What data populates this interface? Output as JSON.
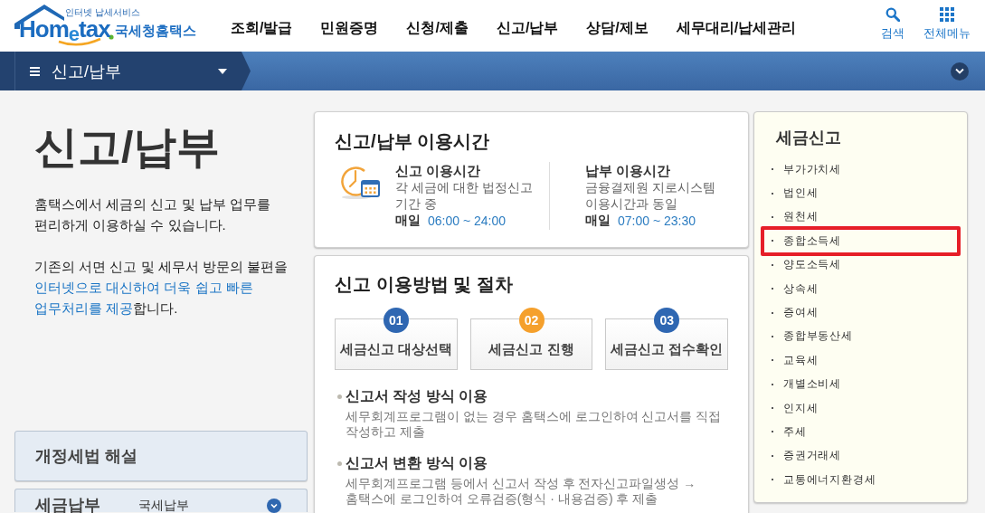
{
  "header": {
    "logo": {
      "tagline": "인터넷 납세서비스",
      "wordmark": "Hom$_{e}$tax",
      "site_name": "국세청홈택스"
    },
    "nav": [
      {
        "label": "조회/발급"
      },
      {
        "label": "민원증명"
      },
      {
        "label": "신청/제출"
      },
      {
        "label": "신고/납부"
      },
      {
        "label": "상담/제보"
      },
      {
        "label": "세무대리/납세관리"
      }
    ],
    "utilities": [
      {
        "kind": "search",
        "label": "검색"
      },
      {
        "kind": "all_menu",
        "label": "전체메뉴"
      }
    ]
  },
  "section_bar": {
    "current": "신고/납부"
  },
  "intro": {
    "title": "신고/납부",
    "paragraphs": [
      [
        {
          "kind": "plain",
          "text": "홈택스에서 세금의 신고 및 납부 업무를\n편리하게 이용하실 수 있습니다."
        }
      ],
      [
        {
          "kind": "plain",
          "text": "기존의 서면 신고 및 세무서 방문의 불편을\n"
        },
        {
          "kind": "emphasis",
          "text": "인터넷으로 대신하여 더욱 쉽고 빠른\n업무처리를 제공"
        },
        {
          "kind": "plain",
          "text": "합니다."
        }
      ]
    ]
  },
  "side_links": [
    {
      "label": "개정세법 해설"
    },
    {
      "label": "세금납부",
      "sublabel": "국세납부"
    }
  ],
  "hours": {
    "title": "신고/납부 이용시간",
    "columns": [
      {
        "heading": "신고 이용시간",
        "description": "각 세금에 대한 법정신고\n기간 중",
        "day_label": "매일",
        "time": "06:00 ~ 24:00"
      },
      {
        "heading": "납부 이용시간",
        "description": "금융결제원 지로시스템\n이용시간과 동일",
        "day_label": "매일",
        "time": "07:00 ~ 23:30"
      }
    ]
  },
  "procedure": {
    "title": "신고 이용방법 및 절차",
    "steps": [
      {
        "number": "01",
        "label": "세금신고 대상선택",
        "color": "#2f67b2"
      },
      {
        "number": "02",
        "label": "세금신고 진행",
        "color": "#f5a02c"
      },
      {
        "number": "03",
        "label": "세금신고 접수확인",
        "color": "#2f67b2"
      }
    ],
    "methods": [
      {
        "heading": "신고서 작성 방식 이용",
        "description": "세무회계프로그램이 없는 경우 홈택스에 로그인하여 신고서를 직접\n작성하고 제출"
      },
      {
        "heading": "신고서 변환 방식 이용",
        "description": "세무회계프로그램 등에서 신고서 작성 후 전자신고파일생성 →\n홈택스에 로그인하여 오류검증(형식 · 내용검증) 후 제출"
      }
    ]
  },
  "tax_filing": {
    "title": "세금신고",
    "items": [
      {
        "label": "부가가치세",
        "highlighted": false
      },
      {
        "label": "법인세",
        "highlighted": false
      },
      {
        "label": "원천세",
        "highlighted": false
      },
      {
        "label": "종합소득세",
        "highlighted": true
      },
      {
        "label": "양도소득세",
        "highlighted": false
      },
      {
        "label": "상속세",
        "highlighted": false
      },
      {
        "label": "증여세",
        "highlighted": false
      },
      {
        "label": "종합부동산세",
        "highlighted": false
      },
      {
        "label": "교육세",
        "highlighted": false
      },
      {
        "label": "개별소비세",
        "highlighted": false
      },
      {
        "label": "인지세",
        "highlighted": false
      },
      {
        "label": "주세",
        "highlighted": false
      },
      {
        "label": "증권거래세",
        "highlighted": false
      },
      {
        "label": "교통에너지환경세",
        "highlighted": false
      }
    ]
  }
}
